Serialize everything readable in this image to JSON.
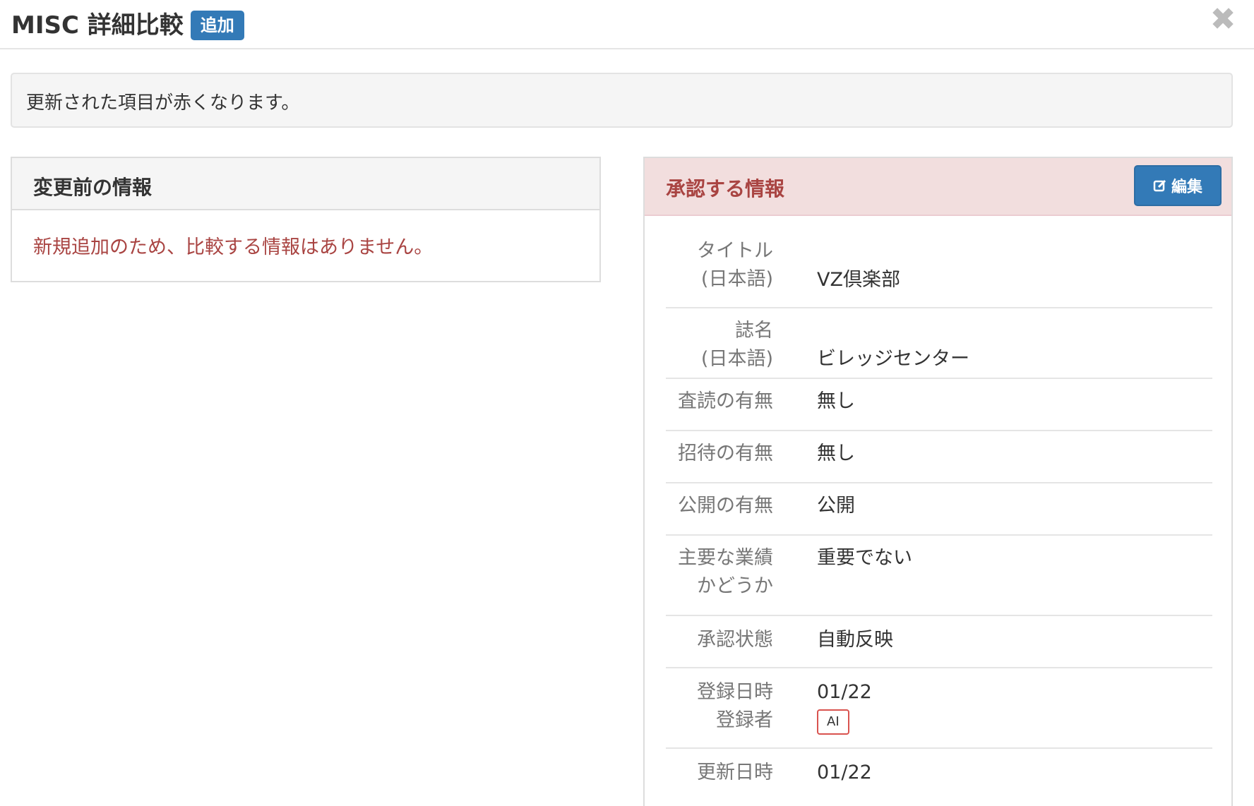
{
  "header": {
    "title": "MISC 詳細比較",
    "badge": "追加",
    "close_symbol": "✖"
  },
  "notice": {
    "text": "更新された項目が赤くなります。"
  },
  "before_panel": {
    "heading": "変更前の情報",
    "message": "新規追加のため、比較する情報はありません。"
  },
  "approve_panel": {
    "heading": "承認する情報",
    "edit_label": "編集",
    "rows": [
      {
        "label": "タイトル\n(日本語)",
        "value": "VZ倶楽部"
      },
      {
        "label": "誌名\n(日本語)",
        "value": "ビレッジセンター"
      },
      {
        "label": "査読の有無",
        "value": "無し"
      },
      {
        "label": "招待の有無",
        "value": "無し"
      },
      {
        "label": "公開の有無",
        "value": "公開"
      },
      {
        "label": "主要な業績\nかどうか",
        "value": "重要でない"
      },
      {
        "label": "承認状態",
        "value": "自動反映"
      },
      {
        "label": "登録日時\n登録者",
        "value": "01/22",
        "badge": "AI"
      },
      {
        "label": "更新日時",
        "value": "01/22"
      }
    ]
  }
}
